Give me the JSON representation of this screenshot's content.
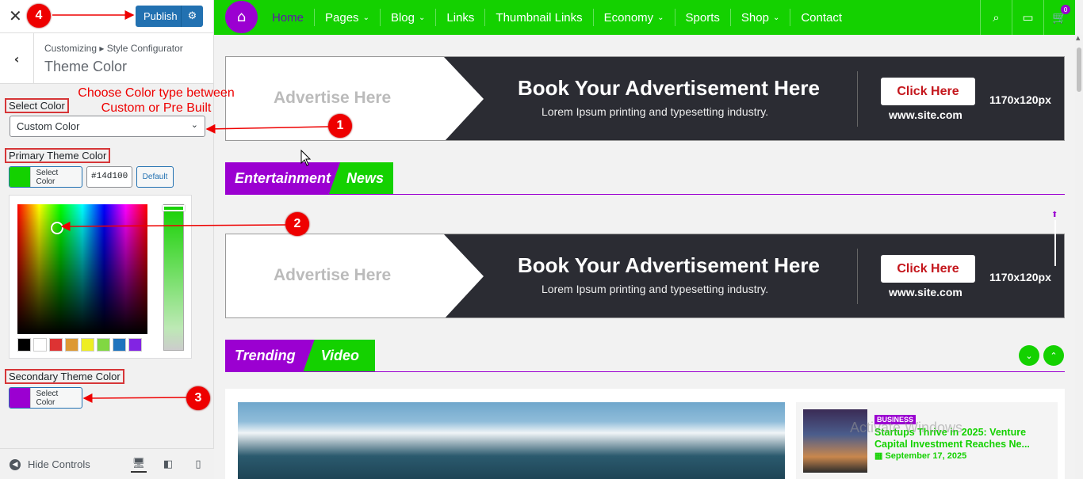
{
  "customizer": {
    "publish_label": "Publish",
    "breadcrumb": "Customizing ▸ Style Configurator",
    "title": "Theme Color",
    "select_color_label": "Select Color",
    "select_value": "Custom Color",
    "primary_label": "Primary Theme Color",
    "primary_color": "#14d100",
    "select_color_btn": "Select Color",
    "hex_value": "#14d100",
    "default_btn": "Default",
    "palette": [
      "#000000",
      "#ffffff",
      "#dd3333",
      "#dd9933",
      "#eeee22",
      "#81d742",
      "#1e73be",
      "#8224e3"
    ],
    "secondary_label": "Secondary Theme Color",
    "secondary_color": "#9b00d1",
    "hide_controls": "Hide Controls"
  },
  "annotations": {
    "note_1_text": "Choose Color type between Custom or Pre Built",
    "steps": [
      "1",
      "2",
      "3",
      "4"
    ]
  },
  "site": {
    "menu": [
      "Home",
      "Pages",
      "Blog",
      "Links",
      "Thumbnail Links",
      "Economy",
      "Sports",
      "Shop",
      "Contact"
    ],
    "menu_has_dropdown": [
      false,
      true,
      true,
      false,
      false,
      true,
      false,
      true,
      false
    ],
    "cart_count": "0",
    "ad": {
      "advertise": "Advertise Here",
      "headline": "Book Your Advertisement Here",
      "sub": "Lorem Ipsum printing and typesetting industry.",
      "cta": "Click Here",
      "url": "www.site.com",
      "size": "1170x120px"
    },
    "section1": {
      "a": "Entertainment",
      "b": "News"
    },
    "section2": {
      "a": "Trending",
      "b": "Video"
    },
    "card": {
      "badge": "BUSINESS",
      "title": "Startups Thrive in 2025: Venture Capital Investment Reaches Ne...",
      "date": "September 17, 2025"
    },
    "watermark": "Activate Windows"
  }
}
